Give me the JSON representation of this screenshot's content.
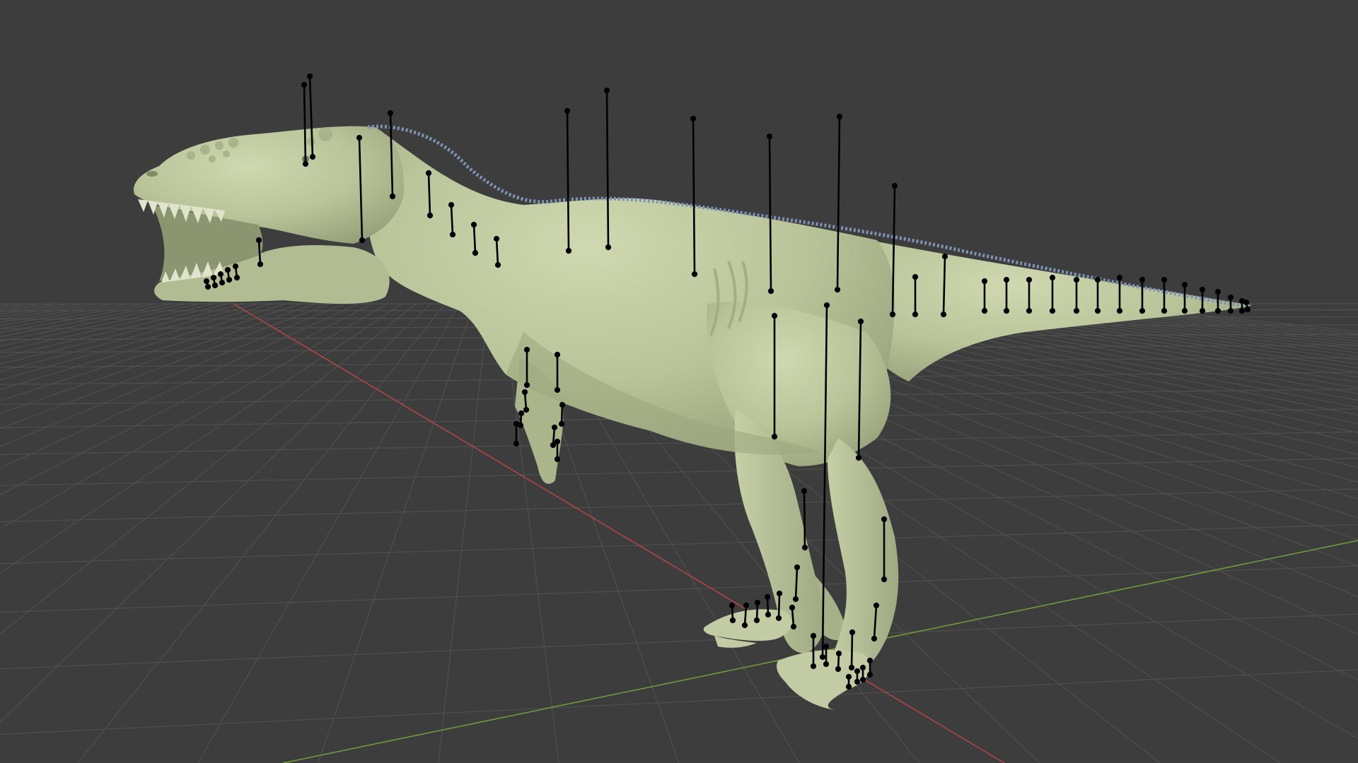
{
  "viewport": {
    "background": "#3d3d3d",
    "grid_color": "#4f4f4f",
    "x_axis_color": "#b04545",
    "y_axis_color": "#6f9a3d"
  },
  "model": {
    "body_color": "#bac59a",
    "shade_color": "#8d9873",
    "highlight_color": "#d3dbb4",
    "spine_color": "#7f93b5",
    "bone_color": "#000000"
  }
}
